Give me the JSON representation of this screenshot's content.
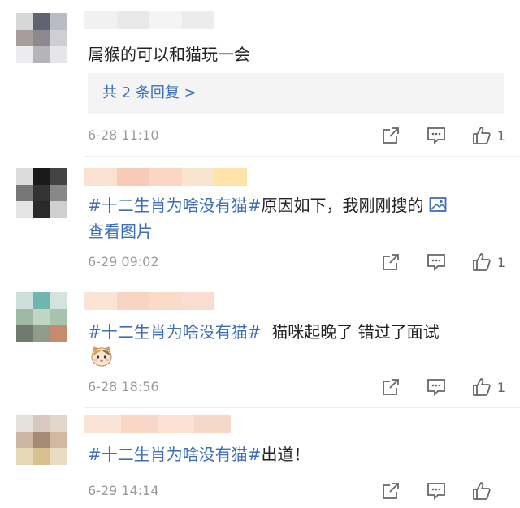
{
  "comments": [
    {
      "body": "属猴的可以和猫玩一会",
      "reply_link": "共 2 条回复 >",
      "time": "6-28 11:10",
      "likes": "1"
    },
    {
      "topic": "#十二生肖为啥没有猫#",
      "body": "原因如下，我刚刚搜的",
      "view_pic": "查看图片",
      "time": "6-29 09:02",
      "likes": "1"
    },
    {
      "topic": "#十二生肖为啥没有猫#",
      "body": "  猫咪起晚了 错过了面试",
      "time": "6-28 18:56",
      "likes": "1"
    },
    {
      "topic": "#十二生肖为啥没有猫#",
      "body": "出道！",
      "time": "6-29 14:14",
      "likes": ""
    }
  ],
  "icons": {
    "share": "share-icon",
    "comment": "comment-icon",
    "like": "thumbs-up-icon",
    "picture": "picture-icon",
    "emoji": "cat-face-emoji"
  },
  "colors": {
    "link": "#3d6fb8",
    "time": "#9a9a9a",
    "reply_bg": "#f4f4f4"
  }
}
